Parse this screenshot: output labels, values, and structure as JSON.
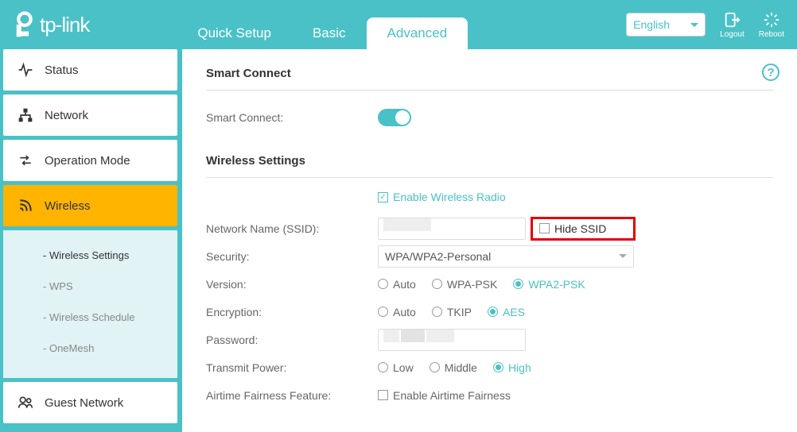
{
  "brand": "tp-link",
  "tabs": {
    "quick": "Quick Setup",
    "basic": "Basic",
    "advanced": "Advanced"
  },
  "language": "English",
  "header_buttons": {
    "logout": "Logout",
    "reboot": "Reboot"
  },
  "sidebar": {
    "status": "Status",
    "network": "Network",
    "operation_mode": "Operation Mode",
    "wireless": "Wireless",
    "guest_network": "Guest Network",
    "sub": {
      "wireless_settings": "Wireless Settings",
      "wps": "WPS",
      "wireless_schedule": "Wireless Schedule",
      "onemesh": "OneMesh"
    }
  },
  "sections": {
    "smart_connect_title": "Smart Connect",
    "smart_connect_label": "Smart Connect:",
    "wireless_settings_title": "Wireless Settings",
    "enable_radio": "Enable Wireless Radio",
    "ssid_label": "Network Name (SSID):",
    "hide_ssid": "Hide SSID",
    "security_label": "Security:",
    "security_value": "WPA/WPA2-Personal",
    "version_label": "Version:",
    "version_options": {
      "auto": "Auto",
      "wpa": "WPA-PSK",
      "wpa2": "WPA2-PSK"
    },
    "encryption_label": "Encryption:",
    "encryption_options": {
      "auto": "Auto",
      "tkip": "TKIP",
      "aes": "AES"
    },
    "password_label": "Password:",
    "transmit_label": "Transmit Power:",
    "transmit_options": {
      "low": "Low",
      "middle": "Middle",
      "high": "High"
    },
    "airtime_label": "Airtime Fairness Feature:",
    "airtime_checkbox": "Enable Airtime Fairness"
  }
}
